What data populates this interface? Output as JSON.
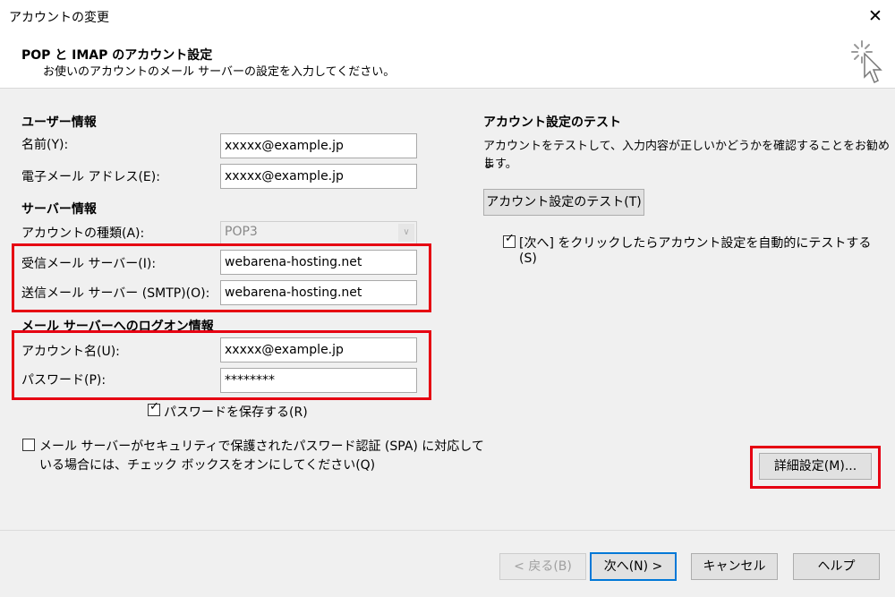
{
  "window": {
    "title": "アカウントの変更",
    "close": "✕"
  },
  "header": {
    "title": "POP と IMAP のアカウント設定",
    "subtitle": "お使いのアカウントのメール サーバーの設定を入力してください。"
  },
  "user_info": {
    "section": "ユーザー情報",
    "name_label": "名前(Y):",
    "name_value": "xxxxx@example.jp",
    "email_label": "電子メール アドレス(E):",
    "email_value": "xxxxx@example.jp"
  },
  "server_info": {
    "section": "サーバー情報",
    "account_type_label": "アカウントの種類(A):",
    "account_type_value": "POP3",
    "incoming_label": "受信メール サーバー(I):",
    "incoming_value": "webarena-hosting.net",
    "outgoing_label": "送信メール サーバー (SMTP)(O):",
    "outgoing_value": "webarena-hosting.net"
  },
  "logon_info": {
    "section": "メール サーバーへのログオン情報",
    "account_name_label": "アカウント名(U):",
    "account_name_value": "xxxxx@example.jp",
    "password_label": "パスワード(P):",
    "password_value": "********",
    "save_password_label": "パスワードを保存する(R)",
    "spa_label_line1": "メール サーバーがセキュリティで保護されたパスワード認証 (SPA) に対応して",
    "spa_label_line2": "いる場合には、チェック ボックスをオンにしてください(Q)"
  },
  "test": {
    "section": "アカウント設定のテスト",
    "desc_line1": "アカウントをテストして、入力内容が正しいかどうかを確認することをお勧めし",
    "desc_line2": "ます。",
    "test_button": "アカウント設定のテスト(T)",
    "auto_test_line1": "[次へ] をクリックしたらアカウント設定を自動的にテストする",
    "auto_test_line2": "(S)"
  },
  "buttons": {
    "advanced": "詳細設定(M)...",
    "back": "< 戻る(B)",
    "next": "次へ(N) >",
    "cancel": "キャンセル",
    "help": "ヘルプ"
  },
  "colors": {
    "highlight": "#e60012",
    "focus": "#0078d7"
  },
  "icons": {
    "close": "close-icon",
    "wizard": "wizard-cursor-icon",
    "check": "check-icon",
    "dropdown": "chevron-down-icon"
  }
}
